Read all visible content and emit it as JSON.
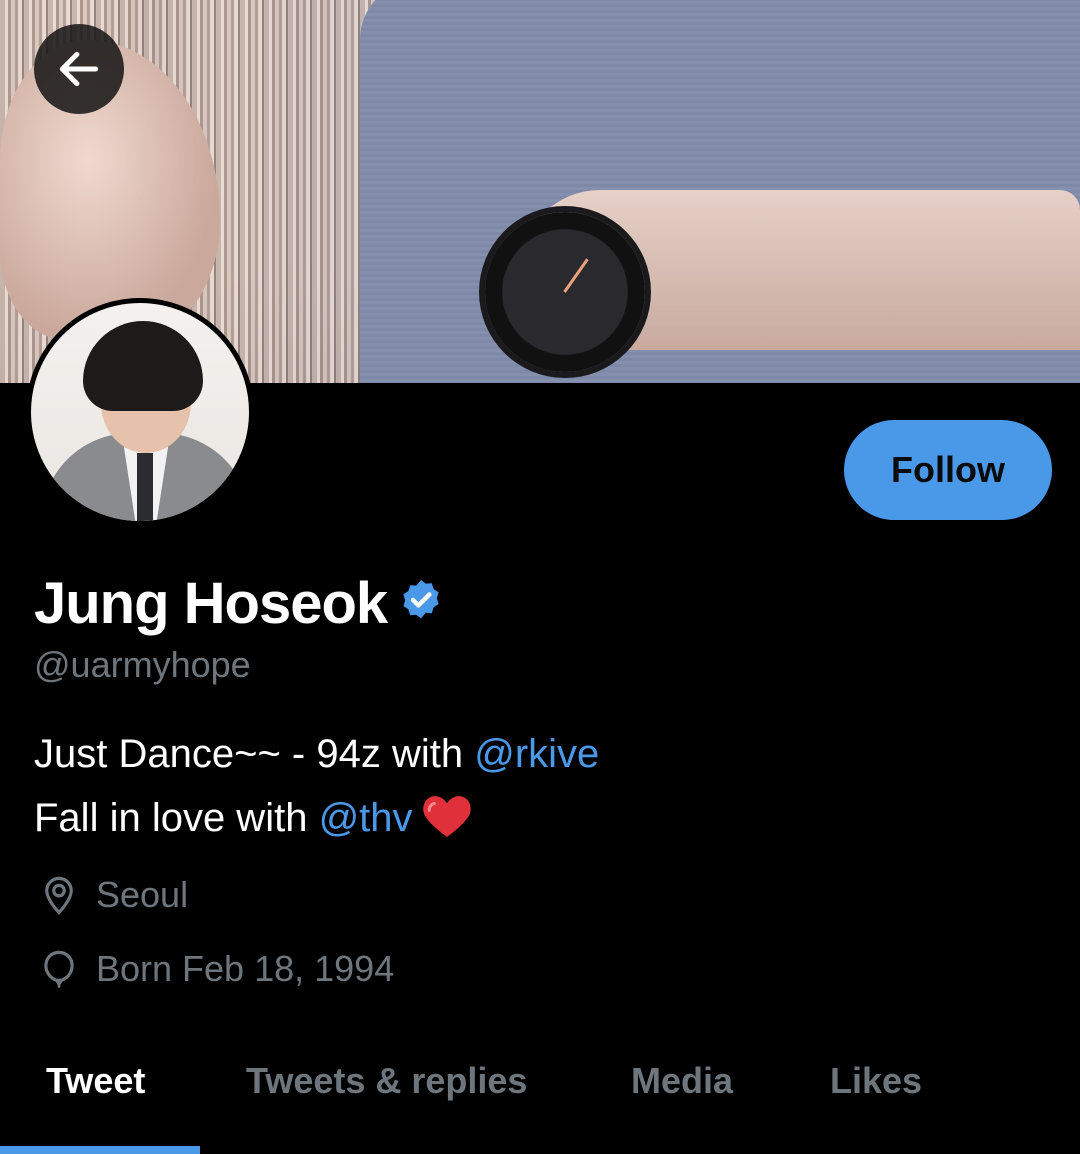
{
  "profile": {
    "display_name": "Jung Hoseok",
    "handle": "@uarmyhope",
    "verified": true,
    "bio": {
      "line1_text": "Just Dance~~ - 94z with ",
      "line1_mention": "@rkive",
      "line2_text": "Fall in love with ",
      "line2_mention": "@thv",
      "emoji": "red-heart"
    },
    "location": "Seoul",
    "birthday": "Born Feb 18, 1994"
  },
  "actions": {
    "follow_label": "Follow"
  },
  "tabs": [
    {
      "label": "Tweet",
      "active": true
    },
    {
      "label": "Tweets & replies",
      "active": false
    },
    {
      "label": "Media",
      "active": false
    },
    {
      "label": "Likes",
      "active": false
    }
  ],
  "icons": {
    "back": "arrow-left-icon",
    "verified": "verified-badge-icon",
    "location": "map-pin-icon",
    "birthday": "balloon-icon"
  },
  "colors": {
    "accent": "#4a99e9",
    "background": "#000000",
    "secondary_text": "#6e767d",
    "primary_text": "#ffffff"
  }
}
